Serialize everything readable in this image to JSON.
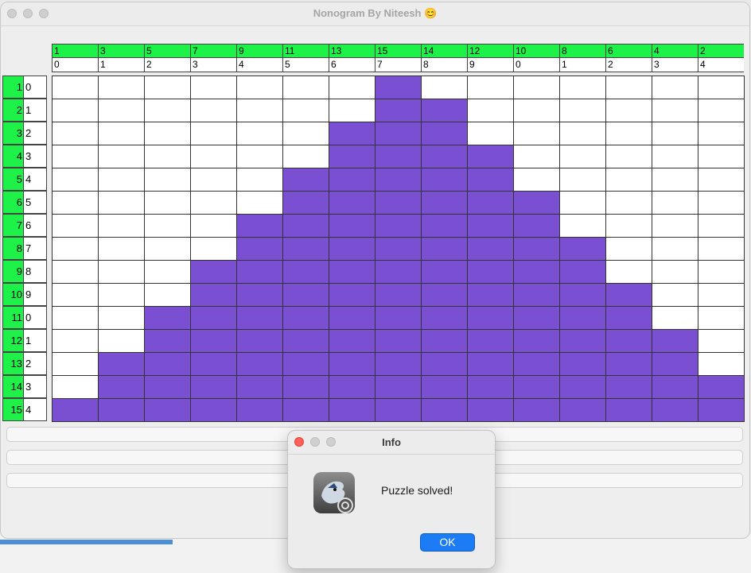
{
  "window": {
    "title": "Nonogram By Niteesh 😊"
  },
  "column_clues": [
    {
      "top": "1",
      "bottom": "0"
    },
    {
      "top": "3",
      "bottom": "1"
    },
    {
      "top": "5",
      "bottom": "2"
    },
    {
      "top": "7",
      "bottom": "3"
    },
    {
      "top": "9",
      "bottom": "4"
    },
    {
      "top": "11",
      "bottom": "5"
    },
    {
      "top": "13",
      "bottom": "6"
    },
    {
      "top": "15",
      "bottom": "7"
    },
    {
      "top": "14",
      "bottom": "8"
    },
    {
      "top": "12",
      "bottom": "9"
    },
    {
      "top": "10",
      "bottom": "0"
    },
    {
      "top": "8",
      "bottom": "1"
    },
    {
      "top": "6",
      "bottom": "2"
    },
    {
      "top": "4",
      "bottom": "3"
    },
    {
      "top": "2",
      "bottom": "4"
    }
  ],
  "row_clues": [
    {
      "clue": "1",
      "index": "0"
    },
    {
      "clue": "2",
      "index": "1"
    },
    {
      "clue": "3",
      "index": "2"
    },
    {
      "clue": "4",
      "index": "3"
    },
    {
      "clue": "5",
      "index": "4"
    },
    {
      "clue": "6",
      "index": "5"
    },
    {
      "clue": "7",
      "index": "6"
    },
    {
      "clue": "8",
      "index": "7"
    },
    {
      "clue": "9",
      "index": "8"
    },
    {
      "clue": "10",
      "index": "9"
    },
    {
      "clue": "11",
      "index": "0"
    },
    {
      "clue": "12",
      "index": "1"
    },
    {
      "clue": "13",
      "index": "2"
    },
    {
      "clue": "14",
      "index": "3"
    },
    {
      "clue": "15",
      "index": "4"
    }
  ],
  "grid_filled": [
    "000000010000000",
    "000000011000000",
    "000000111000000",
    "000000111100000",
    "000001111100000",
    "000001111110000",
    "000011111110000",
    "000011111111000",
    "000111111111000",
    "000111111111100",
    "001111111111100",
    "001111111111110",
    "011111111111110",
    "011111111111111",
    "111111111111111"
  ],
  "colors": {
    "clue_green": "#1ef248",
    "filled": "#7b4fd1",
    "empty": "#ffffff",
    "ok_blue": "#1b7cf5"
  },
  "dialog": {
    "title": "Info",
    "message": "Puzzle solved!",
    "ok_label": "OK",
    "icon": "java-app-icon"
  }
}
